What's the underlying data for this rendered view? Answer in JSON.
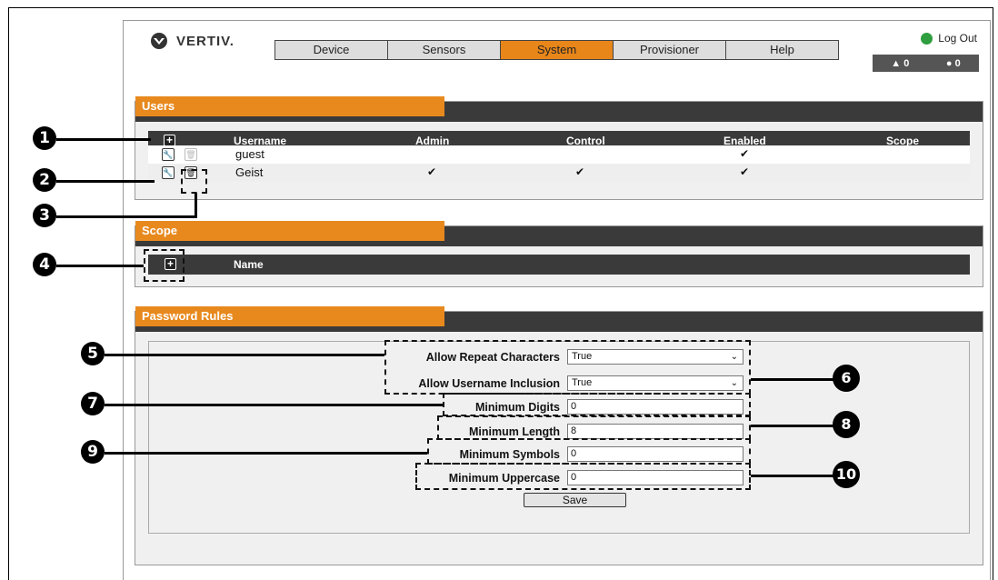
{
  "header": {
    "logo_text": "VERTIV.",
    "nav": [
      "Device",
      "Sensors",
      "System",
      "Provisioner",
      "Help"
    ],
    "active_tab": "System",
    "logout_label": "Log Out",
    "alarm_count": "0",
    "warning_count": "0"
  },
  "users": {
    "title": "Users",
    "columns": [
      "Username",
      "Admin",
      "Control",
      "Enabled",
      "Scope"
    ],
    "rows": [
      {
        "username": "guest",
        "admin": "",
        "control": "",
        "enabled": "✔",
        "scope": ""
      },
      {
        "username": "Geist",
        "admin": "✔",
        "control": "✔",
        "enabled": "✔",
        "scope": ""
      }
    ]
  },
  "scope": {
    "title": "Scope",
    "column": "Name"
  },
  "password_rules": {
    "title": "Password Rules",
    "allow_repeat_label": "Allow Repeat Characters",
    "allow_repeat_value": "True",
    "allow_username_label": "Allow Username Inclusion",
    "allow_username_value": "True",
    "min_digits_label": "Minimum Digits",
    "min_digits_value": "0",
    "min_length_label": "Minimum Length",
    "min_length_value": "8",
    "min_symbols_label": "Minimum Symbols",
    "min_symbols_value": "0",
    "min_uppercase_label": "Minimum Uppercase",
    "min_uppercase_value": "0",
    "save_label": "Save"
  },
  "callouts": [
    "1",
    "2",
    "3",
    "4",
    "5",
    "6",
    "7",
    "8",
    "9",
    "10"
  ],
  "colors": {
    "accent": "#e8891e",
    "dark_bar": "#3a3a3a"
  }
}
